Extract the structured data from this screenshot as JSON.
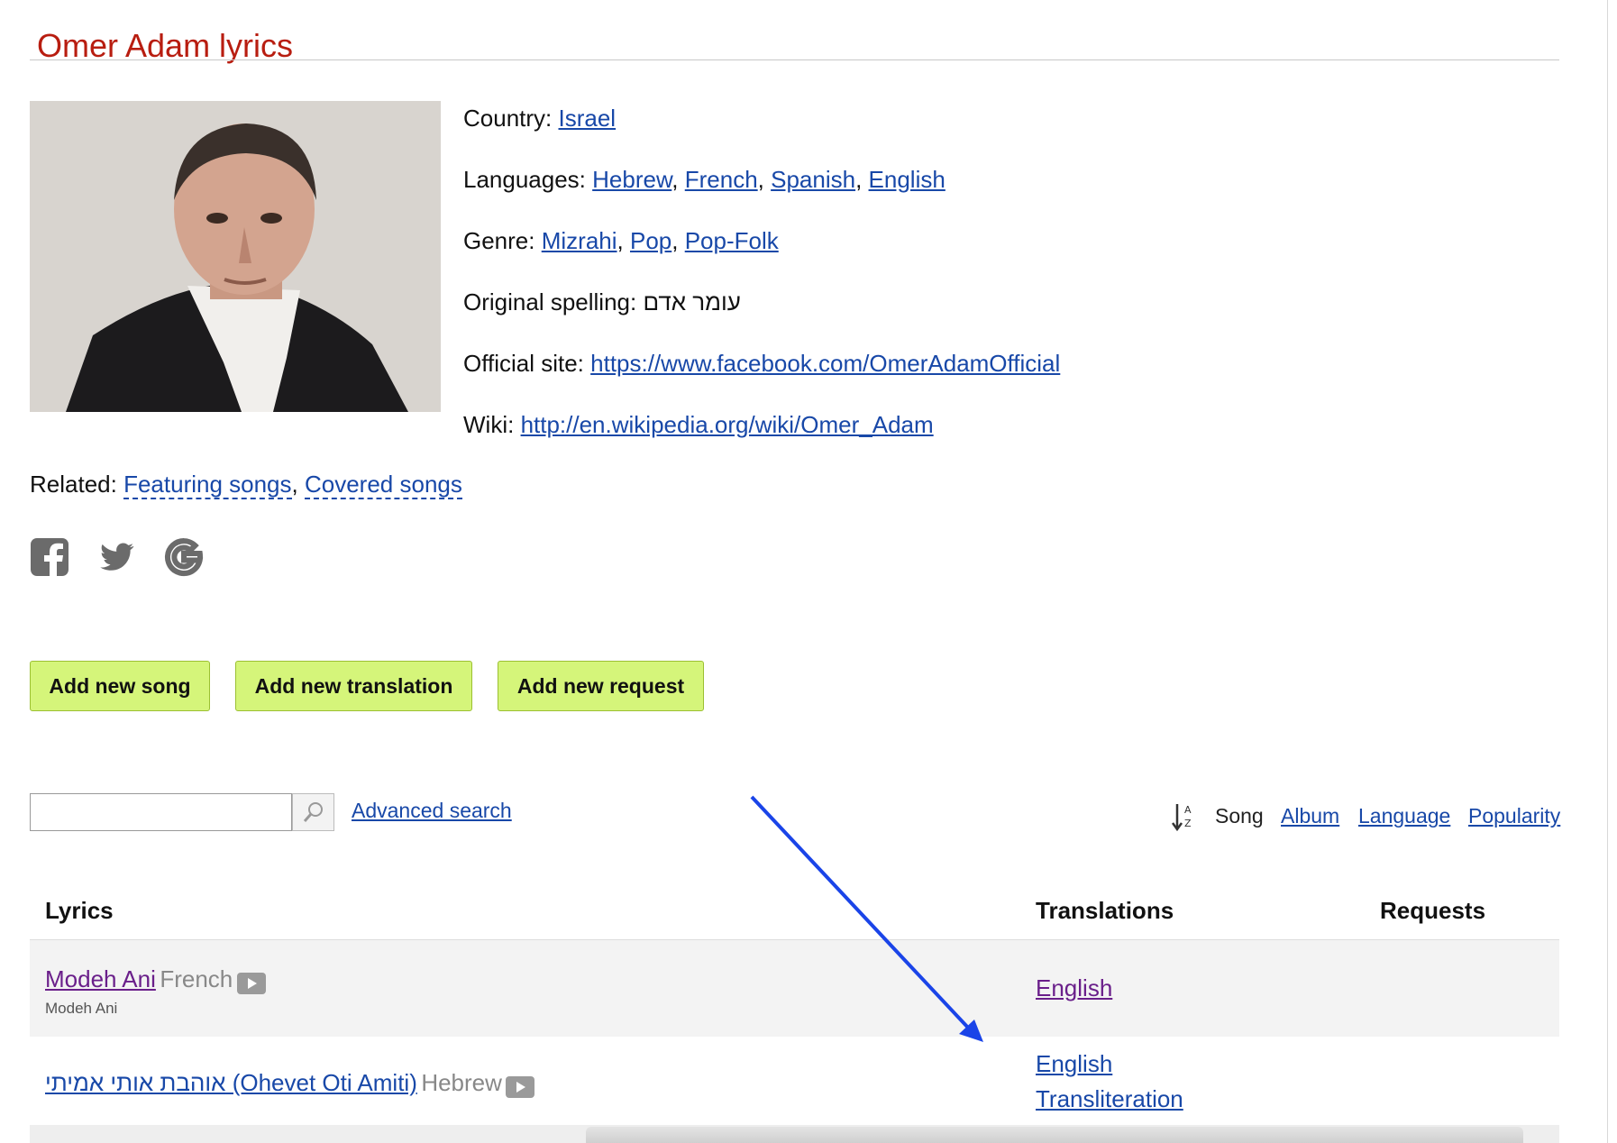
{
  "page": {
    "title": "Omer Adam lyrics"
  },
  "info": {
    "country_label": "Country:",
    "country": "Israel",
    "languages_label": "Languages:",
    "languages": [
      "Hebrew",
      "French",
      "Spanish",
      "English"
    ],
    "genre_label": "Genre:",
    "genres": [
      "Mizrahi",
      "Pop",
      "Pop-Folk"
    ],
    "original_label": "Original spelling:",
    "original_spelling": "עומר אדם",
    "site_label": "Official site:",
    "site_url": "https://www.facebook.com/OmerAdamOfficial",
    "wiki_label": "Wiki:",
    "wiki_url": "http://en.wikipedia.org/wiki/Omer_Adam"
  },
  "related": {
    "label": "Related:",
    "links": [
      "Featuring songs",
      "Covered songs"
    ]
  },
  "social": [
    "facebook-icon",
    "twitter-icon",
    "google-icon"
  ],
  "buttons": {
    "add_song": "Add new song",
    "add_translation": "Add new translation",
    "add_request": "Add new request"
  },
  "search": {
    "value": "",
    "advanced": "Advanced search"
  },
  "sort": {
    "active": "Song",
    "options": [
      "Album",
      "Language",
      "Popularity"
    ]
  },
  "table": {
    "headers": {
      "lyrics": "Lyrics",
      "translations": "Translations",
      "requests": "Requests"
    },
    "rows": [
      {
        "song": "Modeh Ani",
        "language": "French",
        "album": "Modeh Ani",
        "translations": [
          "English"
        ]
      },
      {
        "song": "אוהבת אותי אמיתי (Ohevet Oti Amiti)",
        "language": "Hebrew",
        "album": "",
        "translations": [
          "English",
          "Transliteration"
        ]
      }
    ]
  },
  "colors": {
    "title": "#b81d10",
    "link": "#1848a8",
    "visited": "#6a1f8a",
    "button": "#d5f57a",
    "annotation_arrow": "#1a44e8"
  }
}
